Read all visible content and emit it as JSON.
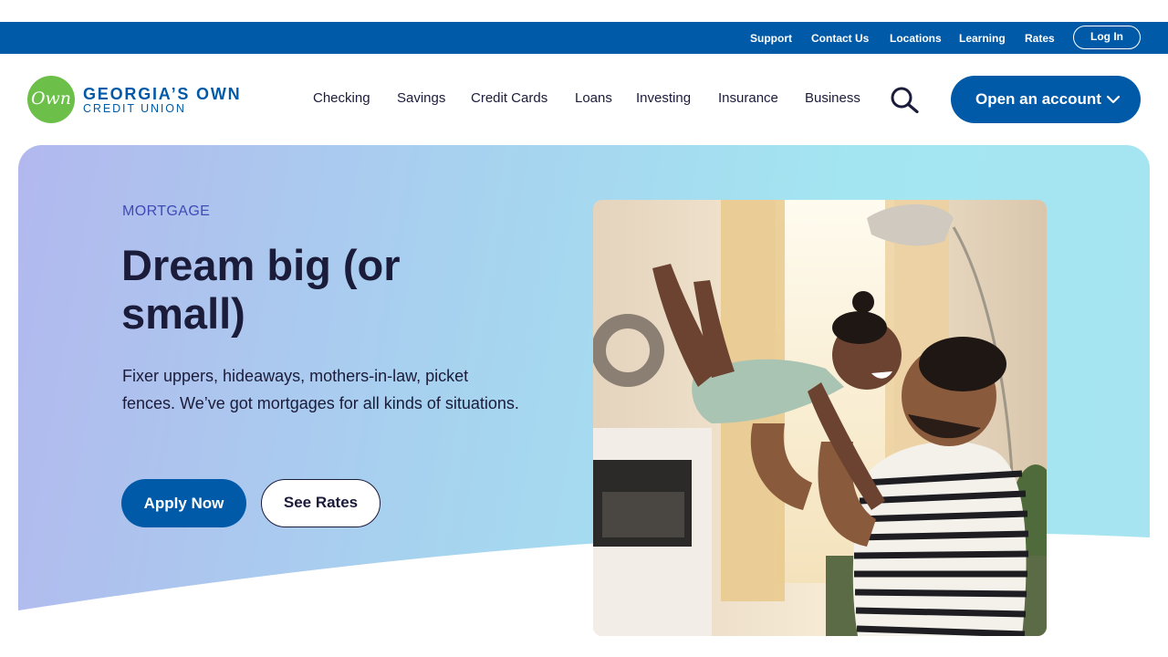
{
  "utility_nav": {
    "links": [
      "Support",
      "Contact Us",
      "Locations",
      "Learning",
      "Rates"
    ],
    "login_label": "Log In"
  },
  "brand": {
    "mark": "Own",
    "name_line1": "GEORGIA’S OWN",
    "name_line2": "CREDIT UNION"
  },
  "main_nav": {
    "items": [
      "Checking",
      "Savings",
      "Credit Cards",
      "Loans",
      "Investing",
      "Insurance",
      "Business"
    ],
    "search_icon": "search-icon",
    "cta_label": "Open an account"
  },
  "hero": {
    "eyebrow": "MORTGAGE",
    "headline": "Dream big (or small)",
    "body": "Fixer uppers, hideaways, mothers-in-law, picket fences. We’ve got mortgages for all kinds of situations.",
    "primary_button": "Apply Now",
    "secondary_button": "See Rates",
    "image_subject": "father-lifting-child-photo"
  },
  "colors": {
    "brand_blue": "#005aa7",
    "brand_green": "#6cc04a",
    "text_dark": "#1b1b3a",
    "eyebrow": "#3f4bb5"
  }
}
